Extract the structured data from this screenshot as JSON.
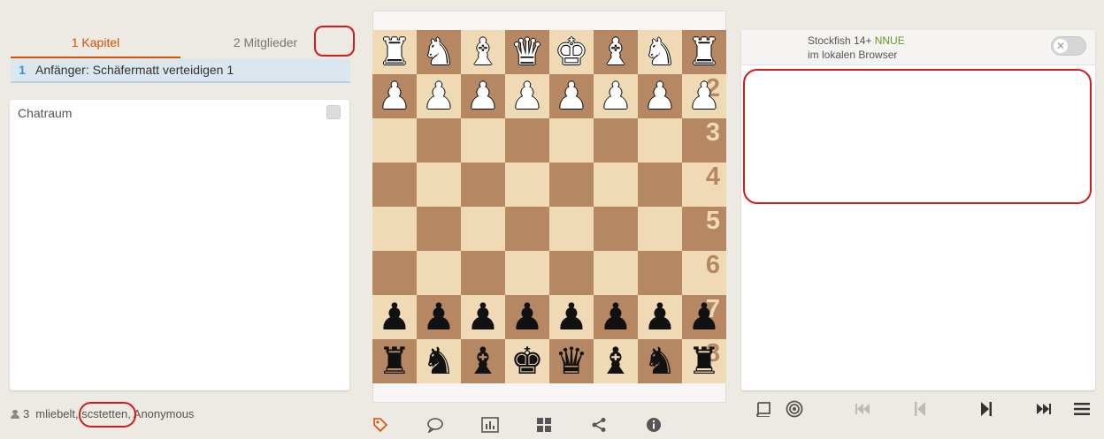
{
  "left": {
    "tabs": [
      {
        "label": "1 Kapitel",
        "active": true
      },
      {
        "label": "2 Mitglieder",
        "active": false
      }
    ],
    "chapter": {
      "number": "1",
      "name": "Anfänger: Schäfermatt verteidigen 1"
    },
    "chat": {
      "title": "Chatraum"
    },
    "members": {
      "count": "3",
      "users": "mliebelt, scstetten, Anonymous"
    }
  },
  "board": {
    "ranks": [
      [
        "♜",
        "♞",
        "♝",
        "♛",
        "♚",
        "♝",
        "♞",
        "♜"
      ],
      [
        "♟",
        "♟",
        "♟",
        "♟",
        "♟",
        "♟",
        "♟",
        "♟"
      ],
      [
        "",
        "",
        "",
        "",
        "",
        "",
        "",
        ""
      ],
      [
        "",
        "",
        "",
        "",
        "",
        "",
        "",
        ""
      ],
      [
        "",
        "",
        "",
        "",
        "",
        "",
        "",
        ""
      ],
      [
        "",
        "",
        "",
        "",
        "",
        "",
        "",
        ""
      ],
      [
        "♟",
        "♟",
        "♟",
        "♟",
        "♟",
        "♟",
        "♟",
        "♟"
      ],
      [
        "♜",
        "♞",
        "♝",
        "♚",
        "♛",
        "♝",
        "♞",
        "♜"
      ]
    ],
    "colors": [
      "w",
      "w",
      "",
      "",
      "",
      "",
      "b",
      "b"
    ],
    "rank_labels": [
      "",
      "2",
      "3",
      "4",
      "5",
      "6",
      "7",
      "8"
    ],
    "tools": [
      "tag-icon",
      "comment-icon",
      "chart-icon",
      "grid-icon",
      "share-icon",
      "info-icon"
    ]
  },
  "engine": {
    "name": "Stockfish 14+",
    "variant": "NNUE",
    "location": "im lokalen Browser"
  },
  "controls": [
    "book-icon",
    "target-icon",
    "first-move-icon",
    "prev-move-icon",
    "next-move-icon",
    "last-move-icon",
    "menu-icon"
  ],
  "colors": {
    "accent": "#d85000",
    "light_square": "#f0d9b5",
    "dark_square": "#b58863",
    "highlight_ring": "#d21c1c"
  }
}
